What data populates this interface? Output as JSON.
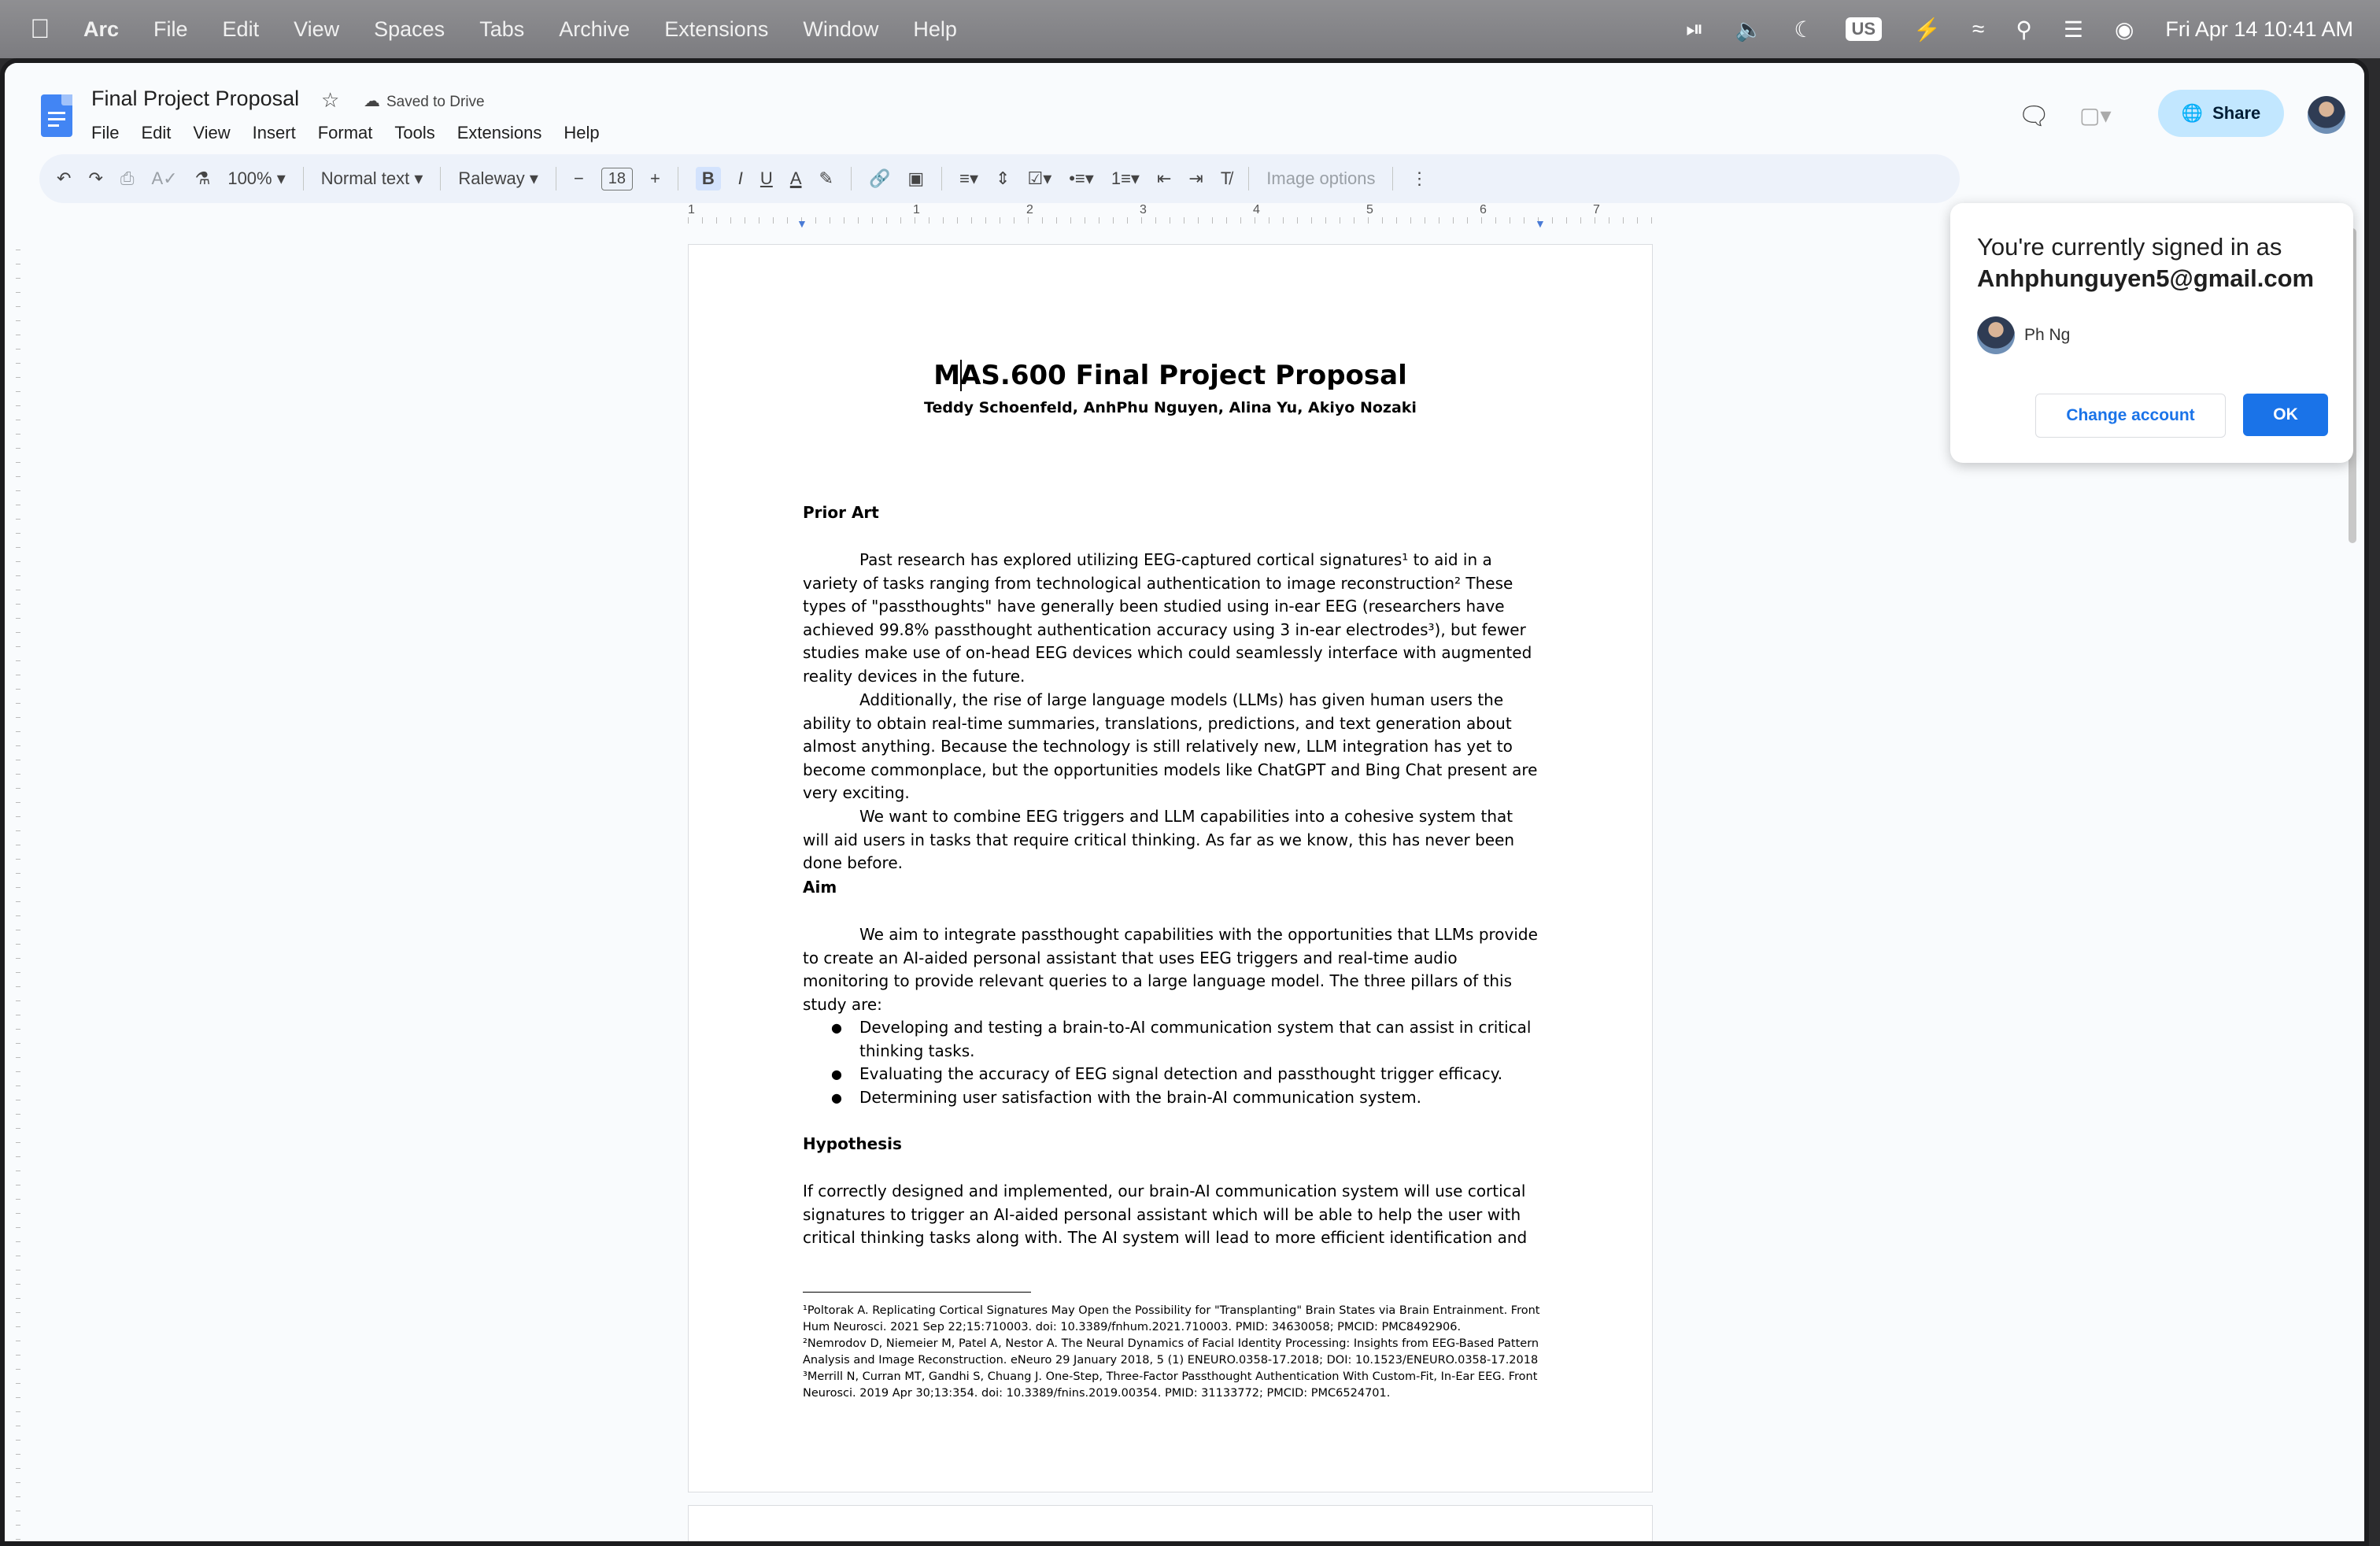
{
  "menubar": {
    "app": "Arc",
    "items": [
      "File",
      "Edit",
      "View",
      "Spaces",
      "Tabs",
      "Archive",
      "Extensions",
      "Window",
      "Help"
    ],
    "keyboard": "US",
    "datetime": "Fri Apr 14  10:41 AM"
  },
  "docs": {
    "title": "Final Project Proposal",
    "saved_status": "Saved to Drive",
    "menu": [
      "File",
      "Edit",
      "View",
      "Insert",
      "Format",
      "Tools",
      "Extensions",
      "Help"
    ],
    "share_label": "Share"
  },
  "toolbar": {
    "zoom": "100%",
    "style": "Normal text",
    "font": "Raleway",
    "font_size": "18",
    "image_options": "Image options"
  },
  "ruler": {
    "labels": [
      "1",
      "1",
      "2",
      "3",
      "4",
      "5",
      "6",
      "7"
    ]
  },
  "document": {
    "title": "MAS.600 Final Project Proposal",
    "authors": "Teddy Schoenfeld, AnhPhu Nguyen, Alina Yu, Akiyo Nozaki",
    "prior_art_heading": "Prior Art",
    "prior_art_p1": "Past research has explored utilizing EEG-captured cortical signatures¹ to aid in a variety of tasks ranging from technological authentication to image reconstruction² These types of \"passthoughts\" have generally been studied using in-ear EEG (researchers have achieved 99.8% passthought authentication accuracy using 3 in-ear electrodes³), but fewer studies make use of on-head EEG devices which could seamlessly interface with augmented reality devices in the future.",
    "prior_art_p2": "Additionally, the rise of large language models (LLMs) has given human users the ability to obtain real-time summaries, translations, predictions, and text generation about almost anything. Because the technology is still relatively new, LLM integration has yet to become commonplace, but the opportunities models like ChatGPT and Bing Chat present are very exciting.",
    "prior_art_p3": "We want to combine EEG triggers and LLM capabilities into a cohesive system that will aid users in tasks that require critical thinking. As far as we know, this has never been done before.",
    "aim_heading": "Aim",
    "aim_p1": "We aim to integrate passthought capabilities with the opportunities that LLMs provide to create an AI-aided personal assistant that uses EEG triggers and real-time audio monitoring to provide relevant queries to a large language model. The three pillars of this study are:",
    "aim_bullets": [
      "Developing and testing a brain-to-AI communication system that can assist in critical thinking tasks.",
      "Evaluating the accuracy of EEG signal detection and passthought trigger efficacy.",
      "Determining user satisfaction with the brain-AI communication system."
    ],
    "hypothesis_heading": "Hypothesis",
    "hypothesis_p1": "If correctly designed and implemented, our brain-AI communication system will use cortical signatures to trigger an AI-aided personal assistant which will be able to help the user with critical thinking tasks along with. The AI system will lead to more efficient identification and",
    "footnotes": [
      "¹Poltorak A. Replicating Cortical Signatures May Open the Possibility for \"Transplanting\" Brain States via Brain Entrainment. Front Hum Neurosci. 2021 Sep 22;15:710003. doi: 10.3389/fnhum.2021.710003. PMID: 34630058; PMCID: PMC8492906.",
      "²Nemrodov D, Niemeier M, Patel A, Nestor A. The Neural Dynamics of Facial Identity Processing: Insights from EEG-Based Pattern Analysis and Image Reconstruction. eNeuro 29 January 2018, 5 (1) ENEURO.0358-17.2018; DOI: 10.1523/ENEURO.0358-17.2018",
      "³Merrill N, Curran MT, Gandhi S, Chuang J. One-Step, Three-Factor Passthought Authentication With Custom-Fit, In-Ear EEG. Front Neurosci. 2019 Apr 30;13:354. doi: 10.3389/fnins.2019.00354. PMID: 31133772; PMCID: PMC6524701."
    ]
  },
  "popup": {
    "title": "You're currently signed in as",
    "email": "Anhphunguyen5@gmail.com",
    "name": "Ph Ng",
    "change_label": "Change account",
    "ok_label": "OK"
  },
  "colors": {
    "accent": "#1a73e8",
    "share_bg": "#c2e7ff",
    "toolbar_bg": "#edf2fa"
  }
}
